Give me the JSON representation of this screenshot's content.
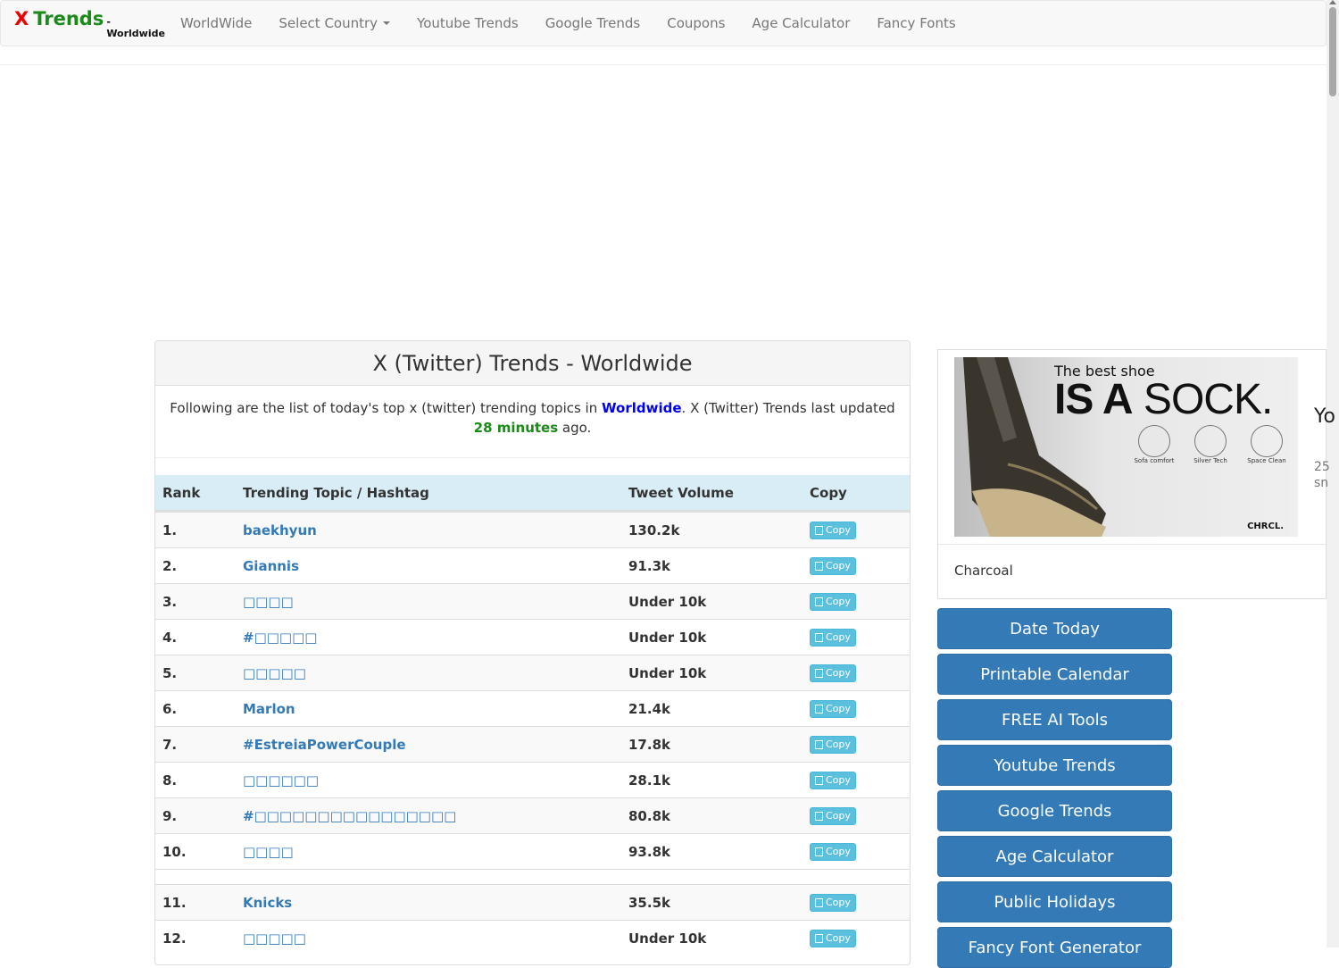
{
  "navbar": {
    "brand_x": "X",
    "brand_trends": "Trends",
    "brand_sub": "- Worldwide",
    "items": [
      {
        "label": "WorldWide"
      },
      {
        "label": "Select Country"
      },
      {
        "label": "Youtube Trends"
      },
      {
        "label": "Google Trends"
      },
      {
        "label": "Coupons"
      },
      {
        "label": "Age Calculator"
      },
      {
        "label": "Fancy Fonts"
      }
    ]
  },
  "panel": {
    "title": "X (Twitter) Trends - Worldwide",
    "intro_prefix": "Following are the list of today's top x (twitter) trending topics in ",
    "intro_country": "Worldwide",
    "intro_middle": ". X (Twitter) Trends last updated ",
    "intro_time": "28 minutes",
    "intro_suffix": " ago."
  },
  "table": {
    "headers": {
      "rank": "Rank",
      "topic": "Trending Topic / Hashtag",
      "volume": "Tweet Volume",
      "copy": "Copy"
    },
    "copy_label": "Copy",
    "rows": [
      {
        "rank": "1.",
        "topic": "baekhyun",
        "volume": "130.2k"
      },
      {
        "rank": "2.",
        "topic": "Giannis",
        "volume": "91.3k"
      },
      {
        "rank": "3.",
        "topic": "□□□□",
        "volume": "Under 10k"
      },
      {
        "rank": "4.",
        "topic": "#□□□□□",
        "volume": "Under 10k"
      },
      {
        "rank": "5.",
        "topic": "□□□□□",
        "volume": "Under 10k"
      },
      {
        "rank": "6.",
        "topic": "Marlon",
        "volume": "21.4k"
      },
      {
        "rank": "7.",
        "topic": "#EstreiaPowerCouple",
        "volume": "17.8k"
      },
      {
        "rank": "8.",
        "topic": "□□□□□□",
        "volume": "28.1k"
      },
      {
        "rank": "9.",
        "topic": "#□□□□□□□□□□□□□□□□",
        "volume": "80.8k"
      },
      {
        "rank": "10.",
        "topic": "□□□□",
        "volume": "93.8k"
      },
      {
        "rank": "11.",
        "topic": "Knicks",
        "volume": "35.5k"
      },
      {
        "rank": "12.",
        "topic": "□□□□□",
        "volume": "Under 10k"
      }
    ]
  },
  "ad": {
    "tagline_small": "The best shoe",
    "tagline_is_a": "IS A",
    "tagline_sock": "SOCK.",
    "features": [
      "Sofa comfort",
      "Silver Tech",
      "Space Clean"
    ],
    "logo": "CHRCL.",
    "caption": "Charcoal",
    "side_text_1": "Yo",
    "side_text_2a": "25",
    "side_text_2b": "sn"
  },
  "sidebar_buttons": [
    {
      "label": "Date Today"
    },
    {
      "label": "Printable Calendar"
    },
    {
      "label": "FREE AI Tools"
    },
    {
      "label": "Youtube Trends"
    },
    {
      "label": "Google Trends"
    },
    {
      "label": "Age Calculator"
    },
    {
      "label": "Public Holidays"
    },
    {
      "label": "Fancy Font Generator"
    }
  ]
}
